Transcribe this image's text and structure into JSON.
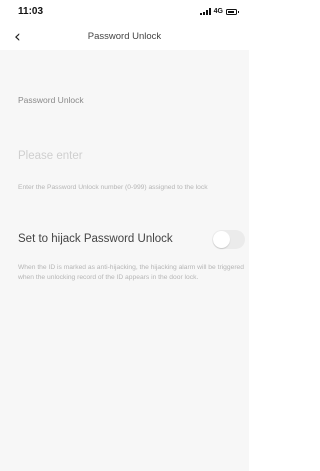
{
  "status_bar": {
    "time": "11:03",
    "network": "4G",
    "battery_level": 0.85
  },
  "nav": {
    "back_icon": "chevron-left-icon",
    "title": "Password Unlock"
  },
  "form": {
    "section_label": "Password Unlock",
    "input_placeholder": "Please enter",
    "hint": "Enter the Password Unlock number (0-999) assigned to the lock"
  },
  "hijack": {
    "label": "Set to hijack Password Unlock",
    "enabled": false,
    "description": "When the ID is marked as anti-hijacking, the hijacking alarm will be triggered when the unlocking record of the ID appears in the door lock."
  }
}
